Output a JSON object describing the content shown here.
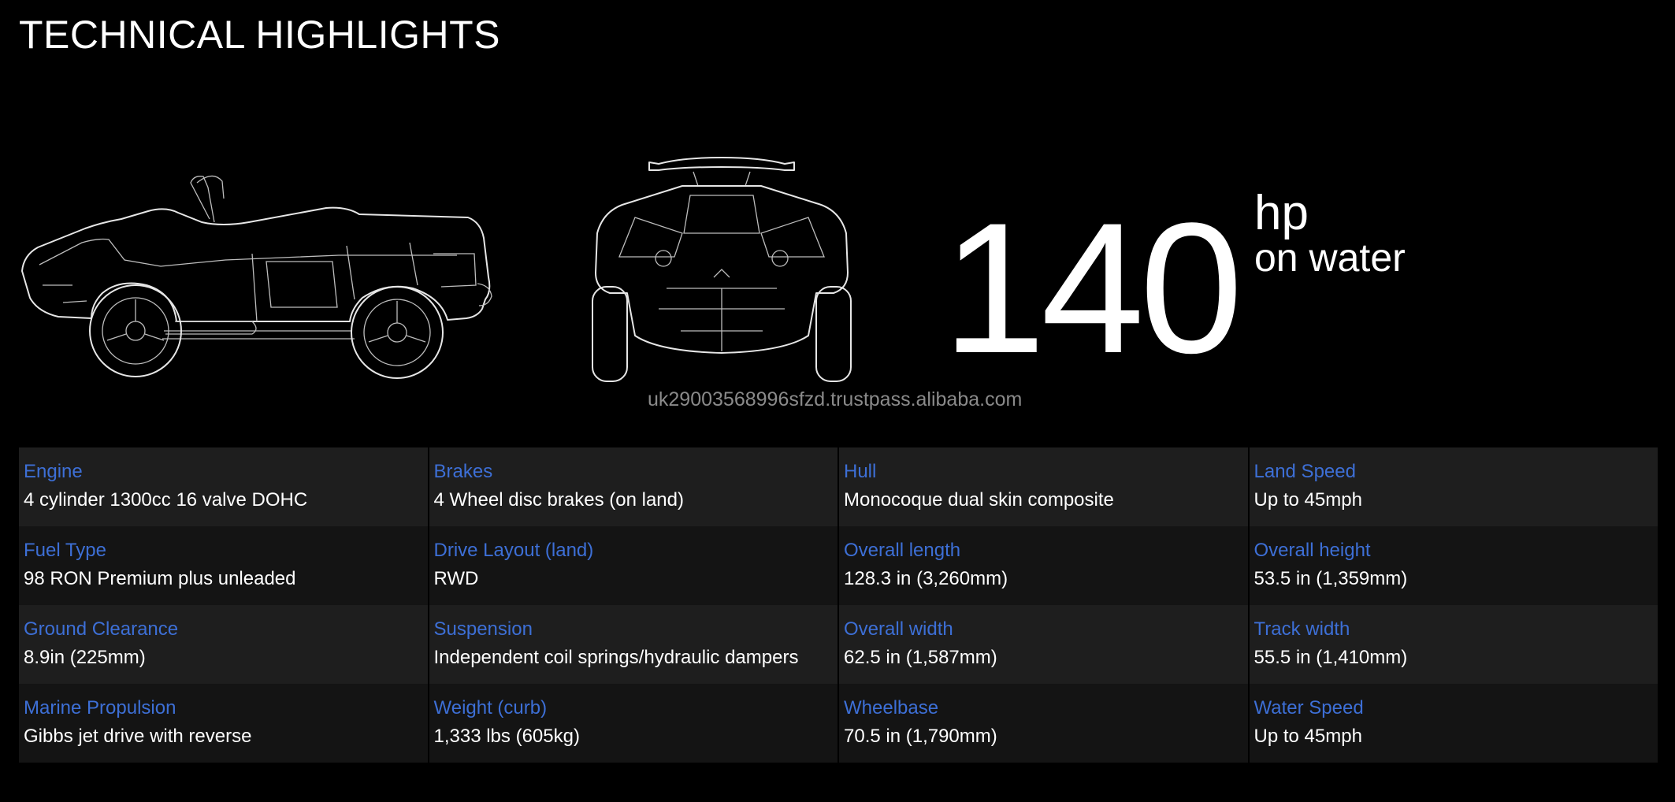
{
  "page": {
    "title": "TECHNICAL HIGHLIGHTS",
    "highlight": {
      "number": "140",
      "unit": "hp",
      "subtext": "on water"
    },
    "watermark": "uk29003568996sfzd.trustpass.alibaba.com"
  },
  "illustrations": {
    "side": "side-view-wireframe",
    "rear": "rear-view-wireframe"
  },
  "colors": {
    "background": "#000000",
    "label": "#3d6fd6",
    "value": "#ffffff",
    "row_light": "#1e1e1e",
    "row_dark": "#141414"
  },
  "specs": {
    "rows": [
      [
        {
          "label": "Engine",
          "value": "4 cylinder 1300cc 16 valve DOHC"
        },
        {
          "label": "Brakes",
          "value": "4 Wheel disc brakes (on land)"
        },
        {
          "label": "Hull",
          "value": "Monocoque dual skin composite"
        },
        {
          "label": "Land Speed",
          "value": "Up to 45mph"
        }
      ],
      [
        {
          "label": "Fuel Type",
          "value": "98 RON Premium plus unleaded"
        },
        {
          "label": "Drive Layout (land)",
          "value": "RWD"
        },
        {
          "label": "Overall length",
          "value": "128.3 in (3,260mm)"
        },
        {
          "label": "Overall height",
          "value": "53.5 in (1,359mm)"
        }
      ],
      [
        {
          "label": "Ground Clearance",
          "value": "8.9in (225mm)"
        },
        {
          "label": "Suspension",
          "value": "Independent coil springs/hydraulic dampers"
        },
        {
          "label": "Overall width",
          "value": "62.5 in (1,587mm)"
        },
        {
          "label": "Track width",
          "value": "55.5 in (1,410mm)"
        }
      ],
      [
        {
          "label": "Marine Propulsion",
          "value": "Gibbs jet drive with reverse"
        },
        {
          "label": "Weight (curb)",
          "value": "1,333 lbs (605kg)"
        },
        {
          "label": "Wheelbase",
          "value": "70.5 in (1,790mm)"
        },
        {
          "label": "Water Speed",
          "value": "Up to 45mph"
        }
      ]
    ]
  }
}
